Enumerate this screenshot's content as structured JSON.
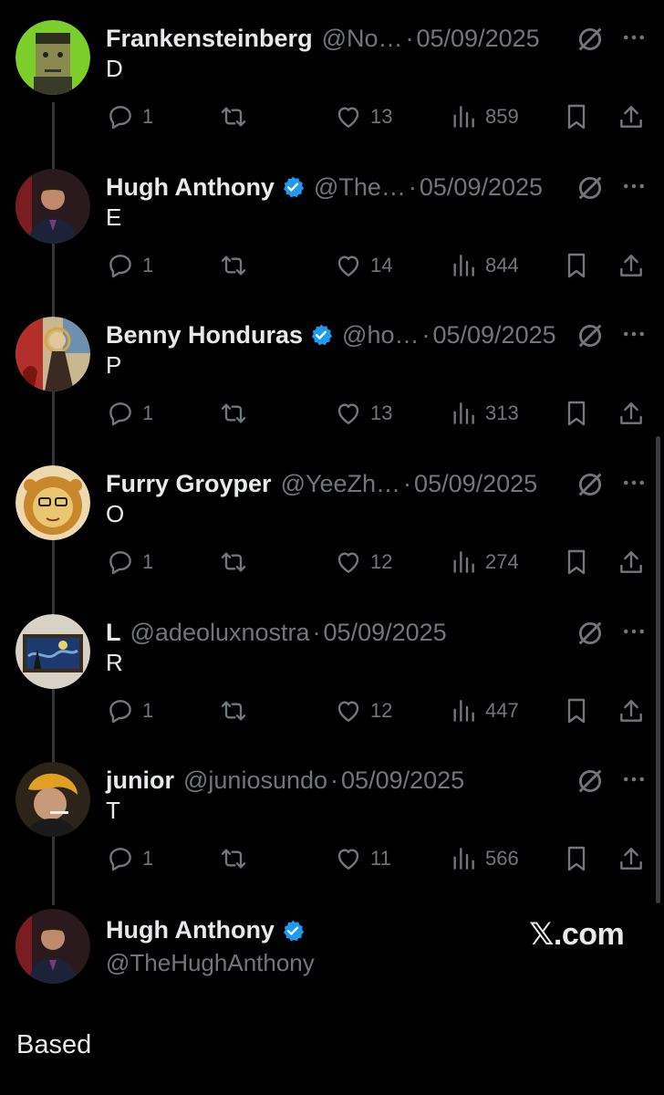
{
  "tweets": [
    {
      "name": "Frankensteinberg",
      "verified": false,
      "handle": "@No…",
      "date": "05/09/2025",
      "text": "D",
      "replies": "1",
      "likes": "13",
      "views": "859"
    },
    {
      "name": "Hugh Anthony",
      "verified": true,
      "handle": "@The…",
      "date": "05/09/2025",
      "text": "E",
      "replies": "1",
      "likes": "14",
      "views": "844"
    },
    {
      "name": "Benny Honduras",
      "verified": true,
      "handle": "@ho…",
      "date": "05/09/2025",
      "text": "P",
      "replies": "1",
      "likes": "13",
      "views": "313"
    },
    {
      "name": "Furry Groyper",
      "verified": false,
      "handle": "@YeeZh…",
      "date": "05/09/2025",
      "text": "O",
      "replies": "1",
      "likes": "12",
      "views": "274"
    },
    {
      "name": "L",
      "verified": false,
      "handle": "@adeoluxnostra",
      "date": "05/09/2025",
      "text": "R",
      "replies": "1",
      "likes": "12",
      "views": "447"
    },
    {
      "name": "junior",
      "verified": false,
      "handle": "@juniosundo",
      "date": "05/09/2025",
      "text": "T",
      "replies": "1",
      "likes": "11",
      "views": "566"
    }
  ],
  "footer": {
    "name": "Hugh Anthony",
    "handle": "@TheHughAnthony",
    "brand": "𝕏.com",
    "text": "Based"
  },
  "colors": {
    "background": "#000000",
    "text": "#e7e9ea",
    "muted": "#71767b",
    "verified": "#1d9bf0",
    "thread_line": "#333639"
  },
  "icons": [
    "reply-icon",
    "retweet-icon",
    "like-icon",
    "views-icon",
    "bookmark-icon",
    "share-icon",
    "grok-icon",
    "more-icon",
    "verified-badge-icon"
  ]
}
